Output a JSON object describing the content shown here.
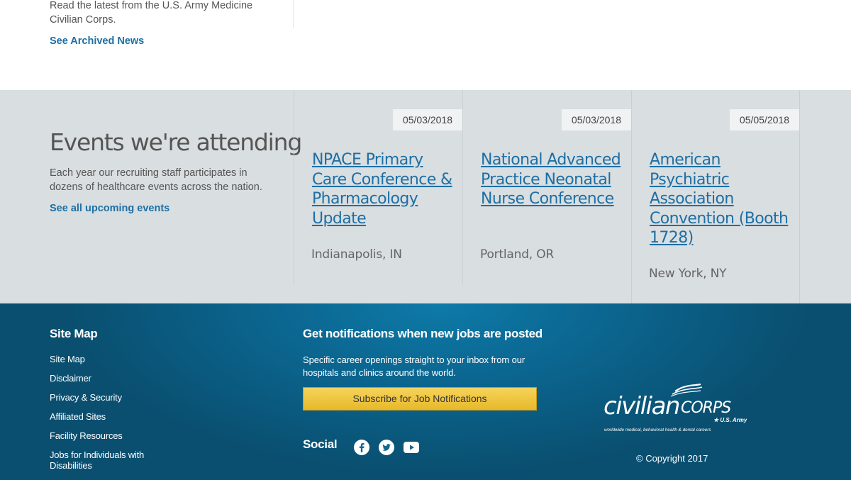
{
  "news": {
    "text": "Read the latest from the U.S. Army Medicine Civilian Corps.",
    "archive_link": "See Archived News"
  },
  "events": {
    "title": "Events we're attending",
    "description": "Each year our recruiting staff participates in dozens of healthcare events across the nation.",
    "link": "See all upcoming events",
    "items": [
      {
        "date": "05/03/2018",
        "name": "NPACE Primary Care Conference & Pharmacology Update",
        "location": "Indianapolis, IN"
      },
      {
        "date": "05/03/2018",
        "name": "National Advanced Practice Neonatal Nurse Conference",
        "location": "Portland, OR"
      },
      {
        "date": "05/05/2018",
        "name": "American Psychiatric Association Convention (Booth 1728)",
        "location": "New York, NY"
      }
    ]
  },
  "footer": {
    "sitemap_heading": "Site Map",
    "sitemap_links": [
      "Site Map",
      "Disclaimer",
      "Privacy & Security",
      "Affiliated Sites",
      "Facility Resources",
      "Jobs for Individuals with Disabilities"
    ],
    "notifications_heading": "Get notifications when new jobs are posted",
    "notifications_desc": "Specific career openings straight to your inbox from our hospitals and clinics around the world.",
    "subscribe_label": "Subscribe for Job Notifications",
    "social_label": "Social",
    "social_icons": [
      "facebook-icon",
      "twitter-icon",
      "youtube-icon"
    ],
    "logo": {
      "word1": "civilian",
      "word2": "CORPS",
      "subtitle": "★ U.S. Army",
      "tagline": "worldwide medical, behavioral health & dental careers"
    },
    "copyright": "© Copyright 2017"
  },
  "colors": {
    "link_blue": "#1d6fa5",
    "events_bg": "#d9dee0",
    "footer_bg": "#0b6690",
    "button_yellow": "#f2c94c"
  }
}
